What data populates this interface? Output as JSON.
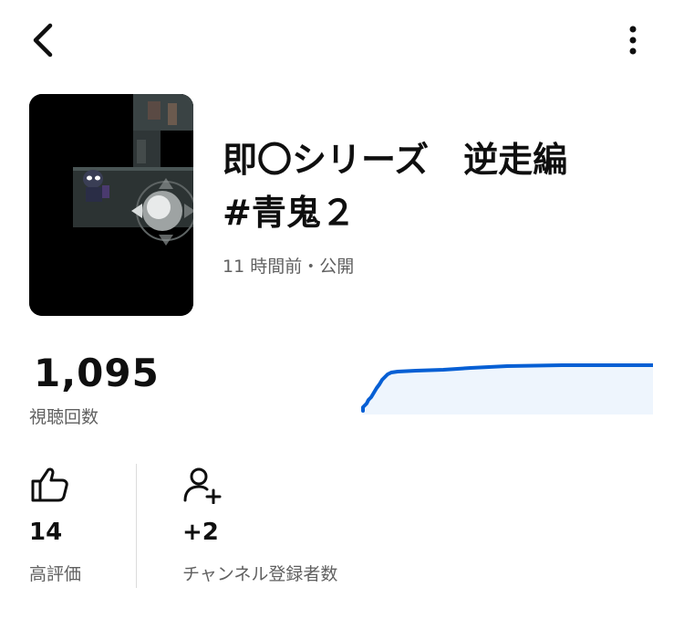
{
  "header": {
    "back_icon": "chevron-left-icon",
    "more_icon": "vertical-dots-icon"
  },
  "video": {
    "title_line1": "即〇シリーズ　逆走編",
    "title_line2": "#青鬼２",
    "published": "11 時間前・公開",
    "thumbnail": "game-screenshot-thumbnail"
  },
  "views": {
    "value": "1,095",
    "label": "視聴回数",
    "trend_color": "#065fd4",
    "trend_fill": "#eef5fd"
  },
  "stats": [
    {
      "icon": "thumbs-up-icon",
      "value": "14",
      "label": "高評価"
    },
    {
      "icon": "add-person-icon",
      "value": "+2",
      "label": "チャンネル登録者数"
    }
  ]
}
